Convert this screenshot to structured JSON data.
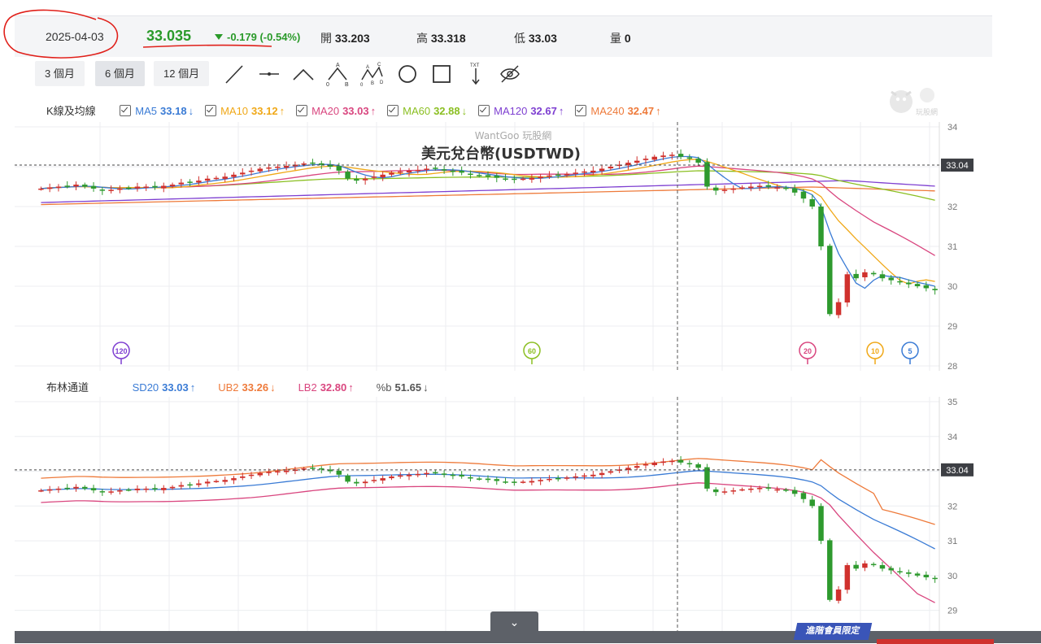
{
  "info": {
    "date": "2025-04-03",
    "price": "33.035",
    "change": "-0.179 (-0.54%)",
    "open_label": "開",
    "open": "33.203",
    "high_label": "高",
    "high": "33.318",
    "low_label": "低",
    "low": "33.03",
    "vol_label": "量",
    "vol": "0"
  },
  "periods": [
    "3 個月",
    "6 個月",
    "12 個月"
  ],
  "tools": [
    "line-tool-icon",
    "horizontal-line-icon",
    "angle-line-icon",
    "abc-pattern-icon",
    "abcd-pattern-icon",
    "circle-tool-icon",
    "rectangle-tool-icon",
    "text-arrow-icon",
    "hide-eye-icon"
  ],
  "tool_text": {
    "a": "A",
    "b": "B",
    "c": "C",
    "d": "D",
    "zero": "0",
    "txt": "TXT"
  },
  "brand": "WantGoo 玩股網",
  "logo_text": "玩股網",
  "chart_title": "美元兌台幣(USDTWD)",
  "ma_legend": {
    "label": "K線及均線",
    "items": [
      {
        "name": "MA5",
        "value": "33.18",
        "arrow": "↓",
        "color": "#3a7bd5"
      },
      {
        "name": "MA10",
        "value": "33.12",
        "arrow": "↑",
        "color": "#f0a818"
      },
      {
        "name": "MA20",
        "value": "33.03",
        "arrow": "↑",
        "color": "#d9467f"
      },
      {
        "name": "MA60",
        "value": "32.88",
        "arrow": "↓",
        "color": "#8bbf22"
      },
      {
        "name": "MA120",
        "value": "32.67",
        "arrow": "↑",
        "color": "#7e3fd1"
      },
      {
        "name": "MA240",
        "value": "32.47",
        "arrow": "↑",
        "color": "#ee7a3a"
      }
    ]
  },
  "boll_legend": {
    "label": "布林通道",
    "items": [
      {
        "name": "SD20",
        "value": "33.03",
        "arrow": "↑",
        "color": "#3a7bd5"
      },
      {
        "name": "UB2",
        "value": "33.26",
        "arrow": "↓",
        "color": "#ee7a3a"
      },
      {
        "name": "LB2",
        "value": "32.80",
        "arrow": "↑",
        "color": "#d9467f"
      },
      {
        "name": "%b",
        "value": "51.65",
        "arrow": "↓",
        "color": "#555"
      }
    ]
  },
  "markers": [
    {
      "label": "120",
      "color": "#7e3fd1"
    },
    {
      "label": "60",
      "color": "#8bbf22"
    },
    {
      "label": "20",
      "color": "#d9467f"
    },
    {
      "label": "10",
      "color": "#f0a818"
    },
    {
      "label": "5",
      "color": "#3a7bd5"
    }
  ],
  "current_price_tag": "33.04",
  "member_label": "進階會員限定",
  "colors": {
    "up": "#d0312d",
    "down": "#2e9a2e",
    "grid": "#eceef1",
    "axis": "#888"
  },
  "chart_data": [
    {
      "type": "candlestick",
      "title": "美元兌台幣(USDTWD)",
      "ylim": [
        28,
        34
      ],
      "yticks": [
        34,
        33,
        32,
        31,
        30,
        29,
        28
      ],
      "current": 33.04,
      "candles_close": [
        32.45,
        32.48,
        32.5,
        32.52,
        32.55,
        32.5,
        32.45,
        32.4,
        32.42,
        32.45,
        32.47,
        32.5,
        32.5,
        32.48,
        32.52,
        32.55,
        32.6,
        32.62,
        32.65,
        32.7,
        32.72,
        32.75,
        32.8,
        32.85,
        32.9,
        32.95,
        32.98,
        33.0,
        33.02,
        33.05,
        33.08,
        33.1,
        33.05,
        33.0,
        32.9,
        32.7,
        32.65,
        32.7,
        32.75,
        32.8,
        32.85,
        32.88,
        32.9,
        32.92,
        32.95,
        32.95,
        32.9,
        32.88,
        32.85,
        32.8,
        32.78,
        32.75,
        32.72,
        32.7,
        32.68,
        32.7,
        32.72,
        32.75,
        32.78,
        32.8,
        32.82,
        32.85,
        32.88,
        32.9,
        32.95,
        33.0,
        33.05,
        33.1,
        33.15,
        33.2,
        33.25,
        33.28,
        33.3,
        33.25,
        33.2,
        33.1,
        32.5,
        32.4,
        32.42,
        32.45,
        32.48,
        32.5,
        32.52,
        32.5,
        32.48,
        32.45,
        32.35,
        32.2,
        32.0,
        31.0,
        29.3,
        29.6,
        30.3,
        30.2,
        30.35,
        30.3,
        30.2,
        30.15,
        30.1,
        30.05,
        30.0,
        29.95,
        29.9
      ],
      "series": [
        {
          "name": "MA5",
          "last": 33.18
        },
        {
          "name": "MA10",
          "last": 33.12
        },
        {
          "name": "MA20",
          "last": 33.03
        },
        {
          "name": "MA60",
          "last": 32.88
        },
        {
          "name": "MA120",
          "last": 32.67
        },
        {
          "name": "MA240",
          "last": 32.47
        }
      ]
    },
    {
      "type": "candlestick",
      "title": "布林通道",
      "ylim": [
        28.5,
        35
      ],
      "yticks": [
        35,
        34,
        33,
        32,
        31,
        30,
        29
      ],
      "current": 33.04,
      "series": [
        {
          "name": "SD20",
          "last": 33.03
        },
        {
          "name": "UB2",
          "last": 33.26
        },
        {
          "name": "LB2",
          "last": 32.8
        }
      ]
    }
  ]
}
